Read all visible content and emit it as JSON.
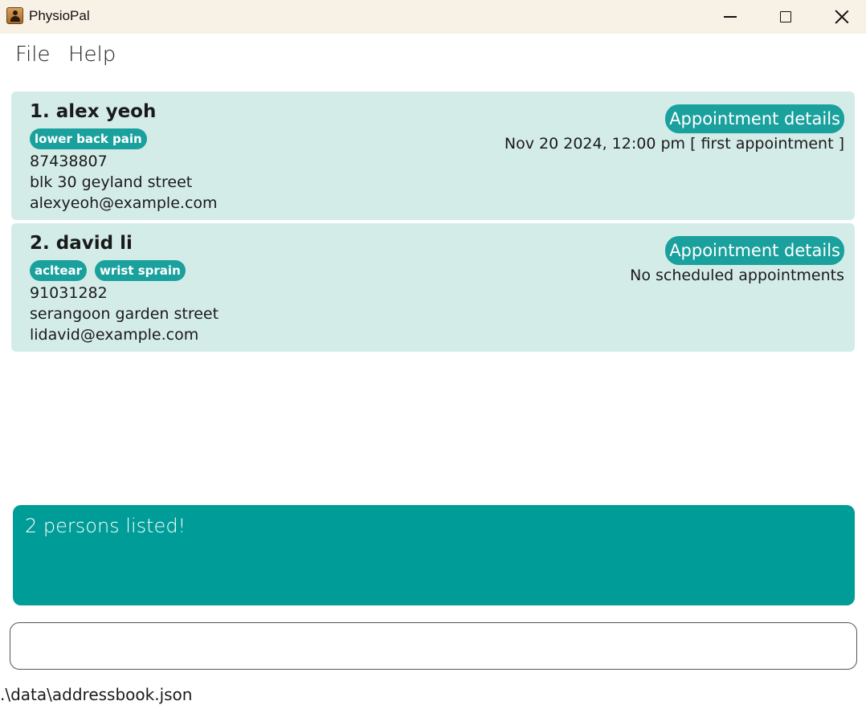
{
  "window": {
    "title": "PhysioPal"
  },
  "menu": {
    "file": "File",
    "help": "Help"
  },
  "persons": [
    {
      "name": "1. alex yeoh",
      "tags": [
        "lower back pain"
      ],
      "phone": "87438807",
      "address": "blk 30 geyland street",
      "email": "alexyeoh@example.com",
      "appointment_button": "Appointment details",
      "appointment": "Nov 20 2024, 12:00 pm [ first appointment ]"
    },
    {
      "name": "2. david li",
      "tags": [
        "acltear",
        "wrist sprain"
      ],
      "phone": "91031282",
      "address": "serangoon garden street",
      "email": "lidavid@example.com",
      "appointment_button": "Appointment details",
      "appointment": "No scheduled appointments"
    }
  ],
  "result": {
    "message": "2 persons listed!"
  },
  "command": {
    "value": "",
    "placeholder": ""
  },
  "status": {
    "path": ".\\data\\addressbook.json"
  },
  "colors": {
    "accent": "#1aa19d",
    "card": "#d4ece8",
    "result": "#009c98",
    "titlebar": "#f8f1e6"
  }
}
